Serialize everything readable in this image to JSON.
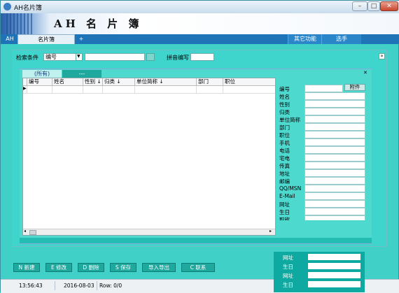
{
  "window": {
    "title": "AH名片簿",
    "app_title": "AH 名 片 簿"
  },
  "tabs": {
    "left": "AH",
    "active": "名片簿",
    "add": "+",
    "right": [
      "其它功能",
      "选手"
    ]
  },
  "search": {
    "label": "检索条件",
    "field_value": "编号",
    "pinyin_label": "拼音编写"
  },
  "inner_tabs": [
    "(所有)",
    "---"
  ],
  "grid": {
    "columns": [
      "编号",
      "姓名",
      "性别 ↓",
      "归类 ↓",
      "单位简称 ↓",
      "部门",
      "职位"
    ]
  },
  "form": {
    "attach_label": "附件",
    "fields": [
      "编号",
      "姓名",
      "性别",
      "归类",
      "单位简称",
      "部门",
      "职位",
      "手机",
      "电话",
      "宅电",
      "传真",
      "地址",
      "邮编",
      "QQ/MSN",
      "E-Mail",
      "网址",
      "生日",
      "职称"
    ]
  },
  "toolbar": [
    "N 新建",
    "E 修改",
    "D 删除",
    "S 保存",
    "导入导出",
    "C 联系"
  ],
  "overlay": [
    "网址",
    "生日",
    "网址",
    "生日"
  ],
  "status": {
    "time": "13:56:43",
    "date": "2016-08-03",
    "row": "Row: 0/0"
  },
  "icons": {
    "minimize": "minimize-icon",
    "maximize": "maximize-icon",
    "close": "close-icon"
  }
}
